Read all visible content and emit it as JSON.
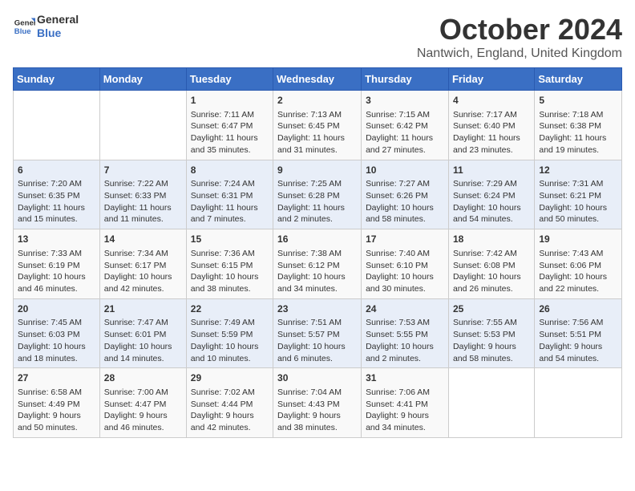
{
  "header": {
    "logo_line1": "General",
    "logo_line2": "Blue",
    "month_title": "October 2024",
    "subtitle": "Nantwich, England, United Kingdom"
  },
  "days_of_week": [
    "Sunday",
    "Monday",
    "Tuesday",
    "Wednesday",
    "Thursday",
    "Friday",
    "Saturday"
  ],
  "weeks": [
    [
      {
        "day": "",
        "sunrise": "",
        "sunset": "",
        "daylight": ""
      },
      {
        "day": "",
        "sunrise": "",
        "sunset": "",
        "daylight": ""
      },
      {
        "day": "1",
        "sunrise": "Sunrise: 7:11 AM",
        "sunset": "Sunset: 6:47 PM",
        "daylight": "Daylight: 11 hours and 35 minutes."
      },
      {
        "day": "2",
        "sunrise": "Sunrise: 7:13 AM",
        "sunset": "Sunset: 6:45 PM",
        "daylight": "Daylight: 11 hours and 31 minutes."
      },
      {
        "day": "3",
        "sunrise": "Sunrise: 7:15 AM",
        "sunset": "Sunset: 6:42 PM",
        "daylight": "Daylight: 11 hours and 27 minutes."
      },
      {
        "day": "4",
        "sunrise": "Sunrise: 7:17 AM",
        "sunset": "Sunset: 6:40 PM",
        "daylight": "Daylight: 11 hours and 23 minutes."
      },
      {
        "day": "5",
        "sunrise": "Sunrise: 7:18 AM",
        "sunset": "Sunset: 6:38 PM",
        "daylight": "Daylight: 11 hours and 19 minutes."
      }
    ],
    [
      {
        "day": "6",
        "sunrise": "Sunrise: 7:20 AM",
        "sunset": "Sunset: 6:35 PM",
        "daylight": "Daylight: 11 hours and 15 minutes."
      },
      {
        "day": "7",
        "sunrise": "Sunrise: 7:22 AM",
        "sunset": "Sunset: 6:33 PM",
        "daylight": "Daylight: 11 hours and 11 minutes."
      },
      {
        "day": "8",
        "sunrise": "Sunrise: 7:24 AM",
        "sunset": "Sunset: 6:31 PM",
        "daylight": "Daylight: 11 hours and 7 minutes."
      },
      {
        "day": "9",
        "sunrise": "Sunrise: 7:25 AM",
        "sunset": "Sunset: 6:28 PM",
        "daylight": "Daylight: 11 hours and 2 minutes."
      },
      {
        "day": "10",
        "sunrise": "Sunrise: 7:27 AM",
        "sunset": "Sunset: 6:26 PM",
        "daylight": "Daylight: 10 hours and 58 minutes."
      },
      {
        "day": "11",
        "sunrise": "Sunrise: 7:29 AM",
        "sunset": "Sunset: 6:24 PM",
        "daylight": "Daylight: 10 hours and 54 minutes."
      },
      {
        "day": "12",
        "sunrise": "Sunrise: 7:31 AM",
        "sunset": "Sunset: 6:21 PM",
        "daylight": "Daylight: 10 hours and 50 minutes."
      }
    ],
    [
      {
        "day": "13",
        "sunrise": "Sunrise: 7:33 AM",
        "sunset": "Sunset: 6:19 PM",
        "daylight": "Daylight: 10 hours and 46 minutes."
      },
      {
        "day": "14",
        "sunrise": "Sunrise: 7:34 AM",
        "sunset": "Sunset: 6:17 PM",
        "daylight": "Daylight: 10 hours and 42 minutes."
      },
      {
        "day": "15",
        "sunrise": "Sunrise: 7:36 AM",
        "sunset": "Sunset: 6:15 PM",
        "daylight": "Daylight: 10 hours and 38 minutes."
      },
      {
        "day": "16",
        "sunrise": "Sunrise: 7:38 AM",
        "sunset": "Sunset: 6:12 PM",
        "daylight": "Daylight: 10 hours and 34 minutes."
      },
      {
        "day": "17",
        "sunrise": "Sunrise: 7:40 AM",
        "sunset": "Sunset: 6:10 PM",
        "daylight": "Daylight: 10 hours and 30 minutes."
      },
      {
        "day": "18",
        "sunrise": "Sunrise: 7:42 AM",
        "sunset": "Sunset: 6:08 PM",
        "daylight": "Daylight: 10 hours and 26 minutes."
      },
      {
        "day": "19",
        "sunrise": "Sunrise: 7:43 AM",
        "sunset": "Sunset: 6:06 PM",
        "daylight": "Daylight: 10 hours and 22 minutes."
      }
    ],
    [
      {
        "day": "20",
        "sunrise": "Sunrise: 7:45 AM",
        "sunset": "Sunset: 6:03 PM",
        "daylight": "Daylight: 10 hours and 18 minutes."
      },
      {
        "day": "21",
        "sunrise": "Sunrise: 7:47 AM",
        "sunset": "Sunset: 6:01 PM",
        "daylight": "Daylight: 10 hours and 14 minutes."
      },
      {
        "day": "22",
        "sunrise": "Sunrise: 7:49 AM",
        "sunset": "Sunset: 5:59 PM",
        "daylight": "Daylight: 10 hours and 10 minutes."
      },
      {
        "day": "23",
        "sunrise": "Sunrise: 7:51 AM",
        "sunset": "Sunset: 5:57 PM",
        "daylight": "Daylight: 10 hours and 6 minutes."
      },
      {
        "day": "24",
        "sunrise": "Sunrise: 7:53 AM",
        "sunset": "Sunset: 5:55 PM",
        "daylight": "Daylight: 10 hours and 2 minutes."
      },
      {
        "day": "25",
        "sunrise": "Sunrise: 7:55 AM",
        "sunset": "Sunset: 5:53 PM",
        "daylight": "Daylight: 9 hours and 58 minutes."
      },
      {
        "day": "26",
        "sunrise": "Sunrise: 7:56 AM",
        "sunset": "Sunset: 5:51 PM",
        "daylight": "Daylight: 9 hours and 54 minutes."
      }
    ],
    [
      {
        "day": "27",
        "sunrise": "Sunrise: 6:58 AM",
        "sunset": "Sunset: 4:49 PM",
        "daylight": "Daylight: 9 hours and 50 minutes."
      },
      {
        "day": "28",
        "sunrise": "Sunrise: 7:00 AM",
        "sunset": "Sunset: 4:47 PM",
        "daylight": "Daylight: 9 hours and 46 minutes."
      },
      {
        "day": "29",
        "sunrise": "Sunrise: 7:02 AM",
        "sunset": "Sunset: 4:44 PM",
        "daylight": "Daylight: 9 hours and 42 minutes."
      },
      {
        "day": "30",
        "sunrise": "Sunrise: 7:04 AM",
        "sunset": "Sunset: 4:43 PM",
        "daylight": "Daylight: 9 hours and 38 minutes."
      },
      {
        "day": "31",
        "sunrise": "Sunrise: 7:06 AM",
        "sunset": "Sunset: 4:41 PM",
        "daylight": "Daylight: 9 hours and 34 minutes."
      },
      {
        "day": "",
        "sunrise": "",
        "sunset": "",
        "daylight": ""
      },
      {
        "day": "",
        "sunrise": "",
        "sunset": "",
        "daylight": ""
      }
    ]
  ]
}
